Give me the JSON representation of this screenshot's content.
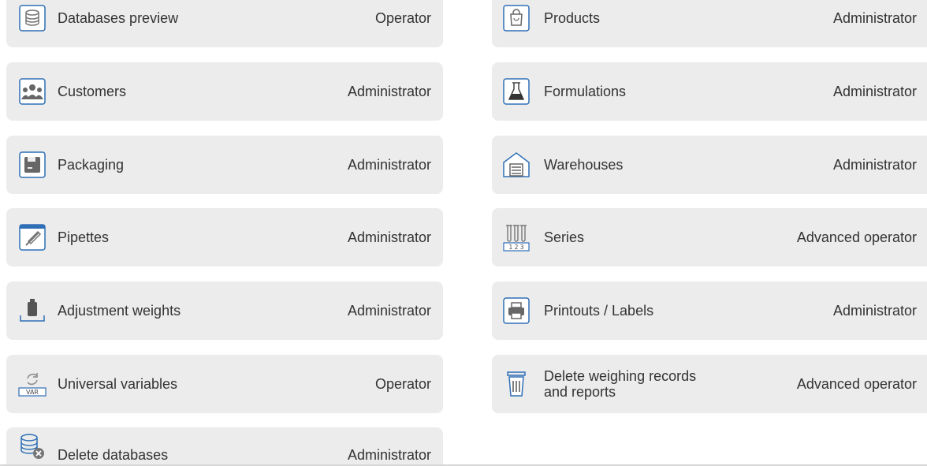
{
  "colors": {
    "tile_background": "#ececec",
    "text": "#333333",
    "icon_accent": "#2f6fb6",
    "icon_gray": "#777777"
  },
  "left_column": [
    {
      "label": "Databases preview",
      "role": "Operator",
      "icon": "database-icon"
    },
    {
      "label": "Customers",
      "role": "Administrator",
      "icon": "customers-icon"
    },
    {
      "label": "Packaging",
      "role": "Administrator",
      "icon": "packaging-icon"
    },
    {
      "label": "Pipettes",
      "role": "Administrator",
      "icon": "pipette-icon"
    },
    {
      "label": "Adjustment weights",
      "role": "Administrator",
      "icon": "weight-icon"
    },
    {
      "label": "Universal variables",
      "role": "Operator",
      "icon": "variables-icon"
    },
    {
      "label": "Delete databases",
      "role": "Administrator",
      "icon": "delete-database-icon"
    }
  ],
  "right_column": [
    {
      "label": "Products",
      "role": "Administrator",
      "icon": "product-bag-icon"
    },
    {
      "label": "Formulations",
      "role": "Administrator",
      "icon": "flask-icon"
    },
    {
      "label": "Warehouses",
      "role": "Administrator",
      "icon": "warehouse-icon"
    },
    {
      "label": "Series",
      "role": "Advanced operator",
      "icon": "series-tubes-icon"
    },
    {
      "label": "Printouts / Labels",
      "role": "Administrator",
      "icon": "printer-icon"
    },
    {
      "label_line1": "Delete weighing records",
      "label_line2": "and reports",
      "role": "Advanced operator",
      "icon": "trash-icon"
    }
  ]
}
